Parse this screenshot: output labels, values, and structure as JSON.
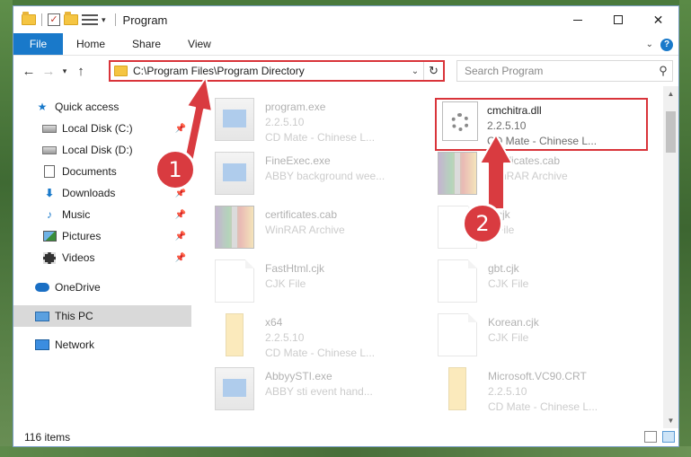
{
  "window": {
    "title": "Program",
    "controls": [
      "minimize",
      "maximize",
      "close"
    ]
  },
  "ribbon": {
    "file_tab": "File",
    "tabs": [
      "Home",
      "Share",
      "View"
    ]
  },
  "address": {
    "path": "C:\\Program Files\\Program Directory"
  },
  "search": {
    "placeholder": "Search Program"
  },
  "sidebar": {
    "items": [
      {
        "label": "Quick access",
        "icon": "star-icon",
        "pinned": false
      },
      {
        "label": "Local Disk (C:)",
        "icon": "drive-icon",
        "pinned": true
      },
      {
        "label": "Local Disk (D:)",
        "icon": "drive-icon",
        "pinned": false
      },
      {
        "label": "Documents",
        "icon": "documents-icon",
        "pinned": true
      },
      {
        "label": "Downloads",
        "icon": "download-icon",
        "pinned": true
      },
      {
        "label": "Music",
        "icon": "music-icon",
        "pinned": true
      },
      {
        "label": "Pictures",
        "icon": "pictures-icon",
        "pinned": true
      },
      {
        "label": "Videos",
        "icon": "videos-icon",
        "pinned": true
      },
      {
        "label": "OneDrive",
        "icon": "cloud-icon",
        "pinned": false
      },
      {
        "label": "This PC",
        "icon": "computer-icon",
        "pinned": false,
        "selected": true
      },
      {
        "label": "Network",
        "icon": "network-icon",
        "pinned": false
      }
    ]
  },
  "files": [
    {
      "name": "program.exe",
      "line2": "2.2.5.10",
      "line3": "CD Mate - Chinese L...",
      "icon": "exe-icon"
    },
    {
      "name": "FineExec.exe",
      "line2": "ABBY background wee...",
      "line3": "",
      "icon": "exe-icon"
    },
    {
      "name": "certificates.cab",
      "line2": "WinRAR Archive",
      "line3": "",
      "icon": "archive-icon"
    },
    {
      "name": "certificates.cab",
      "line2": "WinRAR Archive",
      "line3": "",
      "icon": "archive-icon"
    },
    {
      "name": "...cjk",
      "line2": "...File",
      "line3": "",
      "icon": "file-icon"
    },
    {
      "name": "FastHtml.cjk",
      "line2": "CJK File",
      "line3": "",
      "icon": "file-icon"
    },
    {
      "name": "gbt.cjk",
      "line2": "CJK File",
      "line3": "",
      "icon": "file-icon"
    },
    {
      "name": "x64",
      "line2": "2.2.5.10",
      "line3": "CD Mate - Chinese L...",
      "icon": "folder-icon"
    },
    {
      "name": "Korean.cjk",
      "line2": "CJK File",
      "line3": "",
      "icon": "file-icon"
    },
    {
      "name": "AbbyySTI.exe",
      "line2": "ABBY sti event hand...",
      "line3": "",
      "icon": "exe-icon"
    },
    {
      "name": "Microsoft.VC90.CRT",
      "line2": "2.2.5.10",
      "line3": "CD Mate - Chinese L...",
      "icon": "folder-icon"
    }
  ],
  "highlighted_file": {
    "name": "cmchitra.dll",
    "version": "2.2.5.10",
    "description": "CD Mate - Chinese L...",
    "icon": "dll-gear-icon"
  },
  "callouts": [
    "1",
    "2"
  ],
  "status": {
    "item_count": "116 items"
  },
  "colors": {
    "accent": "#1979ca",
    "highlight": "#d9343a",
    "callout": "#d93b40"
  }
}
